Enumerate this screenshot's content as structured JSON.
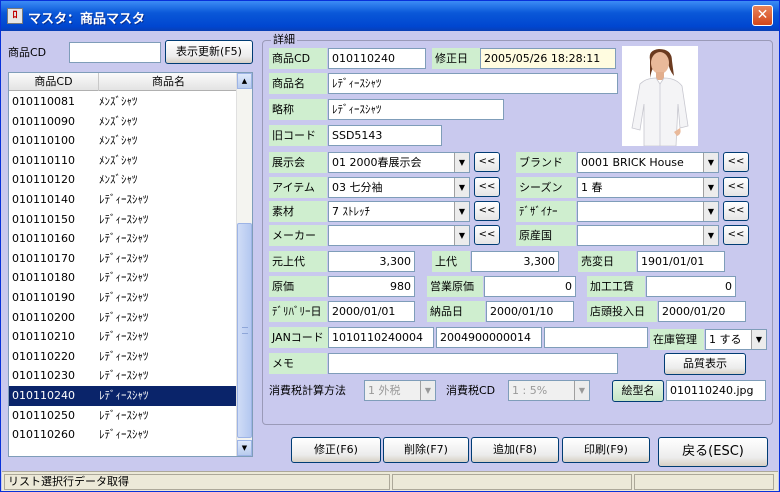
{
  "window": {
    "title": "マスタ：商品マスタ",
    "icon_text": "ﾛ",
    "close_glyph": "✕"
  },
  "search": {
    "label": "商品CD",
    "value": "",
    "refresh_button": "表示更新(F5)"
  },
  "list": {
    "headers": [
      "商品CD",
      "商品名"
    ],
    "rows": [
      {
        "code": "010110081",
        "name": "ﾒﾝｽﾞｼｬﾂ"
      },
      {
        "code": "010110090",
        "name": "ﾒﾝｽﾞｼｬﾂ"
      },
      {
        "code": "010110100",
        "name": "ﾒﾝｽﾞｼｬﾂ"
      },
      {
        "code": "010110110",
        "name": "ﾒﾝｽﾞｼｬﾂ"
      },
      {
        "code": "010110120",
        "name": "ﾒﾝｽﾞｼｬﾂ"
      },
      {
        "code": "010110140",
        "name": "ﾚﾃﾞｨｰｽｼｬﾂ"
      },
      {
        "code": "010110150",
        "name": "ﾚﾃﾞｨｰｽｼｬﾂ"
      },
      {
        "code": "010110160",
        "name": "ﾚﾃﾞｨｰｽｼｬﾂ"
      },
      {
        "code": "010110170",
        "name": "ﾚﾃﾞｨｰｽｼｬﾂ"
      },
      {
        "code": "010110180",
        "name": "ﾚﾃﾞｨｰｽｼｬﾂ"
      },
      {
        "code": "010110190",
        "name": "ﾚﾃﾞｨｰｽｼｬﾂ"
      },
      {
        "code": "010110200",
        "name": "ﾚﾃﾞｨｰｽｼｬﾂ"
      },
      {
        "code": "010110210",
        "name": "ﾚﾃﾞｨｰｽｼｬﾂ"
      },
      {
        "code": "010110220",
        "name": "ﾚﾃﾞｨｰｽｼｬﾂ"
      },
      {
        "code": "010110230",
        "name": "ﾚﾃﾞｨｰｽｼｬﾂ"
      },
      {
        "code": "010110240",
        "name": "ﾚﾃﾞｨｰｽｼｬﾂ"
      },
      {
        "code": "010110250",
        "name": "ﾚﾃﾞｨｰｽｼｬﾂ"
      },
      {
        "code": "010110260",
        "name": "ﾚﾃﾞｨｰｽｼｬﾂ"
      }
    ],
    "selected_index": 15,
    "scroll_up": "▲",
    "scroll_down": "▼",
    "header_scroll_arrow": "▲"
  },
  "detail": {
    "group_title": "詳細",
    "product_cd_label": "商品CD",
    "product_cd": "010110240",
    "modified_label": "修正日",
    "modified": "2005/05/26 18:28:11",
    "product_name_label": "商品名",
    "product_name": "ﾚﾃﾞｨｰｽｼｬﾂ",
    "abbrev_label": "略称",
    "abbrev": "ﾚﾃﾞｨｰｽｼｬﾂ",
    "old_code_label": "旧コード",
    "old_code": "SSD5143",
    "exhibition_label": "展示会",
    "exhibition": "01 2000春展示会",
    "brand_label": "ブランド",
    "brand": "0001 BRICK  House",
    "item_label": "アイテム",
    "item": "03 七分袖",
    "season_label": "シーズン",
    "season": "1 春",
    "material_label": "素材",
    "material": "7 ｽﾄﾚｯﾁ",
    "designer_label": "ﾃﾞｻﾞｲﾅｰ",
    "designer": "",
    "maker_label": "メーカー",
    "maker": "",
    "origin_label": "原産国",
    "origin": "",
    "back_button": "<<",
    "dropdown_arrow": "▼",
    "original_price_label": "元上代",
    "original_price": "3,300",
    "price_label": "上代",
    "price": "3,300",
    "release_label": "売変日",
    "release": "1901/01/01",
    "cost_label": "原価",
    "cost": "980",
    "sales_cost_label": "営業原価",
    "sales_cost": "0",
    "processing_label": "加工工賃",
    "processing": "0",
    "delivery_label": "ﾃﾞﾘﾊﾞﾘｰ日",
    "delivery": "2000/01/01",
    "received_label": "納品日",
    "received": "2000/01/10",
    "store_label": "店頭投入日",
    "store": "2000/01/20",
    "jan_label": "JANコード",
    "jan1": "1010110240004",
    "jan2": "2004900000014",
    "jan3": "",
    "stock_label": "在庫管理",
    "stock": "1 する",
    "memo_label": "メモ",
    "memo": "",
    "quality_button": "品質表示",
    "tax_method_label": "消費税計算方法",
    "tax_method": "1 外税",
    "tax_cd_label": "消費税CD",
    "tax_cd": "1 : 5%",
    "picture_button": "絵型名",
    "picture_file": "010110240.jpg"
  },
  "actions": {
    "edit": "修正(F6)",
    "delete": "削除(F7)",
    "add": "追加(F8)",
    "print": "印刷(F9)",
    "back": "戻る(ESC)"
  },
  "status": {
    "text": "リスト選択行データ取得",
    "cell2": "",
    "cell3": ""
  },
  "colors": {
    "background": "#c9c9ee",
    "label_bg": "#cfeecf",
    "selection": "#0a246a",
    "titlebar": "#0046d0"
  }
}
